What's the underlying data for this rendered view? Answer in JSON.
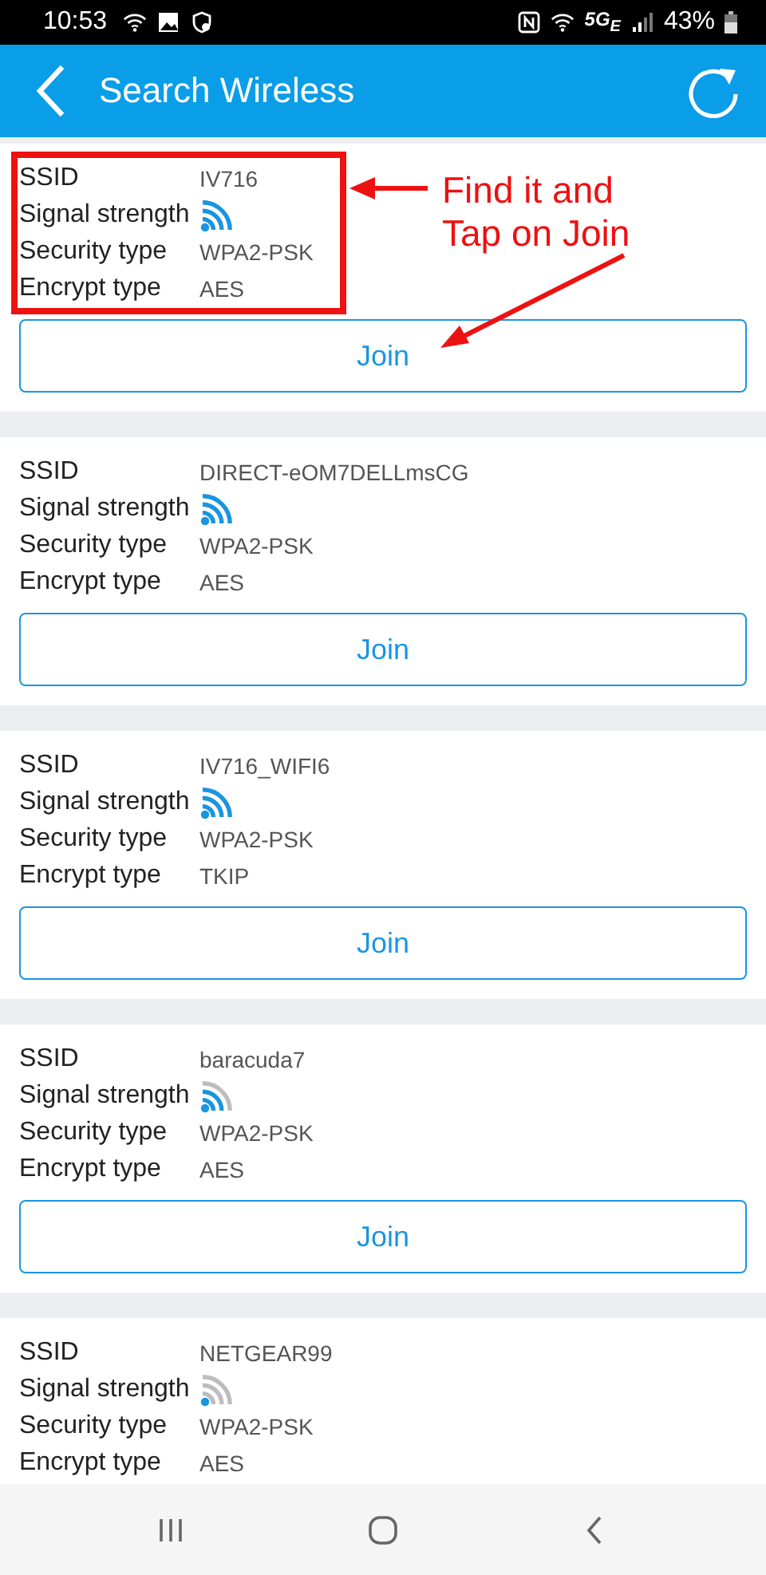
{
  "status_bar": {
    "time": "10:53",
    "network": "5G$_{E}$",
    "battery": "43%"
  },
  "header": {
    "title": "Search Wireless"
  },
  "networks": [
    {
      "kind": "strong",
      "highlighted": true,
      "button": "Join",
      "rows": [
        {
          "label": "SSID",
          "value": "IV716"
        },
        {
          "label": "Signal strength"
        },
        {
          "label": "Security type",
          "value": "WPA2-PSK"
        },
        {
          "label": "Encrypt type",
          "value": "AES"
        }
      ]
    },
    {
      "kind": "strong",
      "highlighted": false,
      "button": "Join",
      "rows": [
        {
          "label": "SSID",
          "value": "DIRECT-eOM7DELLmsCG"
        },
        {
          "label": "Signal strength"
        },
        {
          "label": "Security type",
          "value": "WPA2-PSK"
        },
        {
          "label": "Encrypt type",
          "value": "AES"
        }
      ]
    },
    {
      "kind": "strong",
      "highlighted": false,
      "button": "Join",
      "rows": [
        {
          "label": "SSID",
          "value": "IV716_WIFI6"
        },
        {
          "label": "Signal strength"
        },
        {
          "label": "Security type",
          "value": "WPA2-PSK"
        },
        {
          "label": "Encrypt type",
          "value": "TKIP"
        }
      ]
    },
    {
      "kind": "medium",
      "highlighted": false,
      "button": "Join",
      "rows": [
        {
          "label": "SSID",
          "value": "baracuda7"
        },
        {
          "label": "Signal strength"
        },
        {
          "label": "Security type",
          "value": "WPA2-PSK"
        },
        {
          "label": "Encrypt type",
          "value": "AES"
        }
      ]
    },
    {
      "kind": "weak",
      "highlighted": false,
      "rows": [
        {
          "label": "SSID",
          "value": "NETGEAR99"
        },
        {
          "label": "Signal strength"
        },
        {
          "label": "Security type",
          "value": "WPA2-PSK"
        },
        {
          "label": "Encrypt type",
          "value": "AES"
        }
      ]
    }
  ],
  "annotation": {
    "text": "Find it and Tap on Join"
  }
}
